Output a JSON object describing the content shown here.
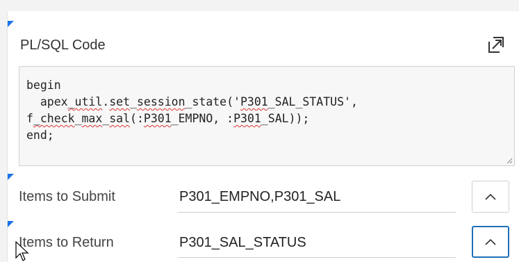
{
  "code_section": {
    "label": "PL/SQL Code",
    "expand_icon": "expand-icon",
    "code_lines": [
      [
        "begin"
      ],
      [
        "  apex",
        "_util",
        ".",
        "set",
        "_",
        "session",
        "_state('",
        "P301",
        "_SAL_STATUS',"
      ],
      [
        "f",
        "_check",
        "_",
        "max",
        "_",
        "sal",
        "(:",
        "P301",
        "_EMPNO, :",
        "P301",
        "_SAL));"
      ],
      [
        "end;"
      ]
    ]
  },
  "items_to_submit": {
    "label": "Items to Submit",
    "value": "P301_EMPNO,P301_SAL",
    "button_icon": "chevron-up-icon"
  },
  "items_to_return": {
    "label": "Items to Return",
    "value": "P301_SAL_STATUS",
    "button_icon": "chevron-up-icon"
  },
  "colors": {
    "marker": "#1a73e8",
    "focus_border": "#1e6fb8",
    "spellcheck": "#dd3333"
  }
}
